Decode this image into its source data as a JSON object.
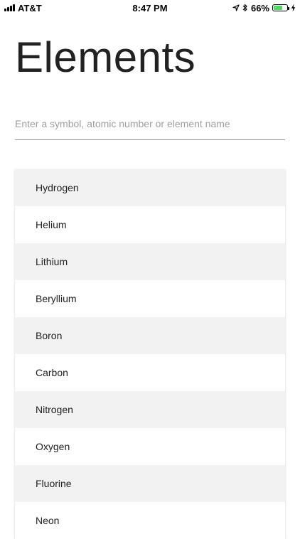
{
  "status_bar": {
    "carrier": "AT&T",
    "time": "8:47 PM",
    "battery_percent": "66%",
    "battery_level": 0.66,
    "icons": [
      "signal-icon",
      "location-icon",
      "bluetooth-icon",
      "battery-icon",
      "charging-icon"
    ]
  },
  "header": {
    "title": "Elements"
  },
  "search": {
    "placeholder": "Enter a symbol, atomic number or element name",
    "value": ""
  },
  "elements": [
    "Hydrogen",
    "Helium",
    "Lithium",
    "Beryllium",
    "Boron",
    "Carbon",
    "Nitrogen",
    "Oxygen",
    "Fluorine",
    "Neon"
  ],
  "colors": {
    "row_shaded": "#f2f2f2",
    "row_plain": "#ffffff",
    "battery_green": "#4cd964"
  }
}
